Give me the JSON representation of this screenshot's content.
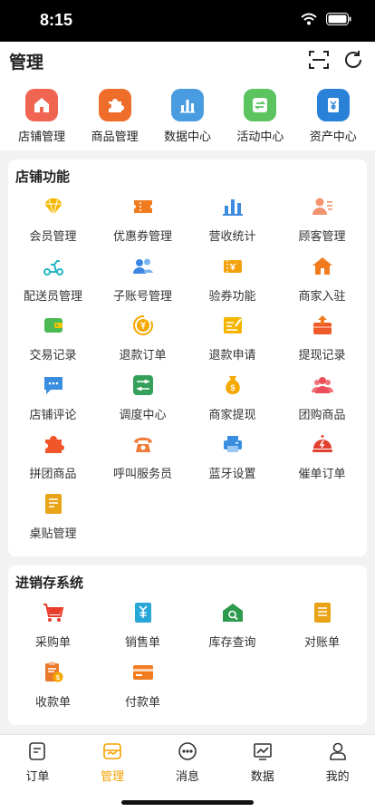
{
  "status": {
    "time": "8:15"
  },
  "header": {
    "title": "管理"
  },
  "quick": [
    {
      "label": "店铺管理",
      "color": "#f06552"
    },
    {
      "label": "商品管理",
      "color": "#ee6d2a"
    },
    {
      "label": "数据中心",
      "color": "#4a9ce0"
    },
    {
      "label": "活动中心",
      "color": "#5cc45f"
    },
    {
      "label": "资产中心",
      "color": "#2a82d8"
    }
  ],
  "store": {
    "title": "店铺功能",
    "items": [
      {
        "label": "会员管理",
        "icon": "diamond-icon"
      },
      {
        "label": "优惠券管理",
        "icon": "coupon-icon"
      },
      {
        "label": "营收统计",
        "icon": "bar-chart-icon"
      },
      {
        "label": "顾客管理",
        "icon": "customer-icon"
      },
      {
        "label": "配送员管理",
        "icon": "scooter-icon"
      },
      {
        "label": "子账号管理",
        "icon": "users-icon"
      },
      {
        "label": "验券功能",
        "icon": "ticket-check-icon"
      },
      {
        "label": "商家入驻",
        "icon": "house-icon"
      },
      {
        "label": "交易记录",
        "icon": "wallet-icon"
      },
      {
        "label": "退款订单",
        "icon": "refund-icon"
      },
      {
        "label": "退款申请",
        "icon": "refund-apply-icon"
      },
      {
        "label": "提现记录",
        "icon": "withdraw-record-icon"
      },
      {
        "label": "店铺评论",
        "icon": "comment-icon"
      },
      {
        "label": "调度中心",
        "icon": "dispatch-icon"
      },
      {
        "label": "商家提现",
        "icon": "money-bag-icon"
      },
      {
        "label": "团购商品",
        "icon": "group-icon"
      },
      {
        "label": "拼团商品",
        "icon": "puzzle-icon"
      },
      {
        "label": "呼叫服务员",
        "icon": "phone-icon"
      },
      {
        "label": "蓝牙设置",
        "icon": "printer-icon"
      },
      {
        "label": "催单订单",
        "icon": "bell-icon"
      },
      {
        "label": "桌贴管理",
        "icon": "sticker-icon"
      }
    ]
  },
  "inventory": {
    "title": "进销存系统",
    "items": [
      {
        "label": "采购单",
        "icon": "cart-icon"
      },
      {
        "label": "销售单",
        "icon": "sales-doc-icon"
      },
      {
        "label": "库存查询",
        "icon": "warehouse-search-icon"
      },
      {
        "label": "对账单",
        "icon": "statement-icon"
      },
      {
        "label": "收款单",
        "icon": "receipt-icon"
      },
      {
        "label": "付款单",
        "icon": "card-icon"
      }
    ]
  },
  "tabs": [
    {
      "label": "订单",
      "icon": "order-icon"
    },
    {
      "label": "管理",
      "icon": "manage-icon"
    },
    {
      "label": "消息",
      "icon": "message-icon"
    },
    {
      "label": "数据",
      "icon": "data-icon"
    },
    {
      "label": "我的",
      "icon": "profile-icon"
    }
  ],
  "colors": {
    "accent": "#f5a100",
    "background": "#f2f2f2"
  }
}
